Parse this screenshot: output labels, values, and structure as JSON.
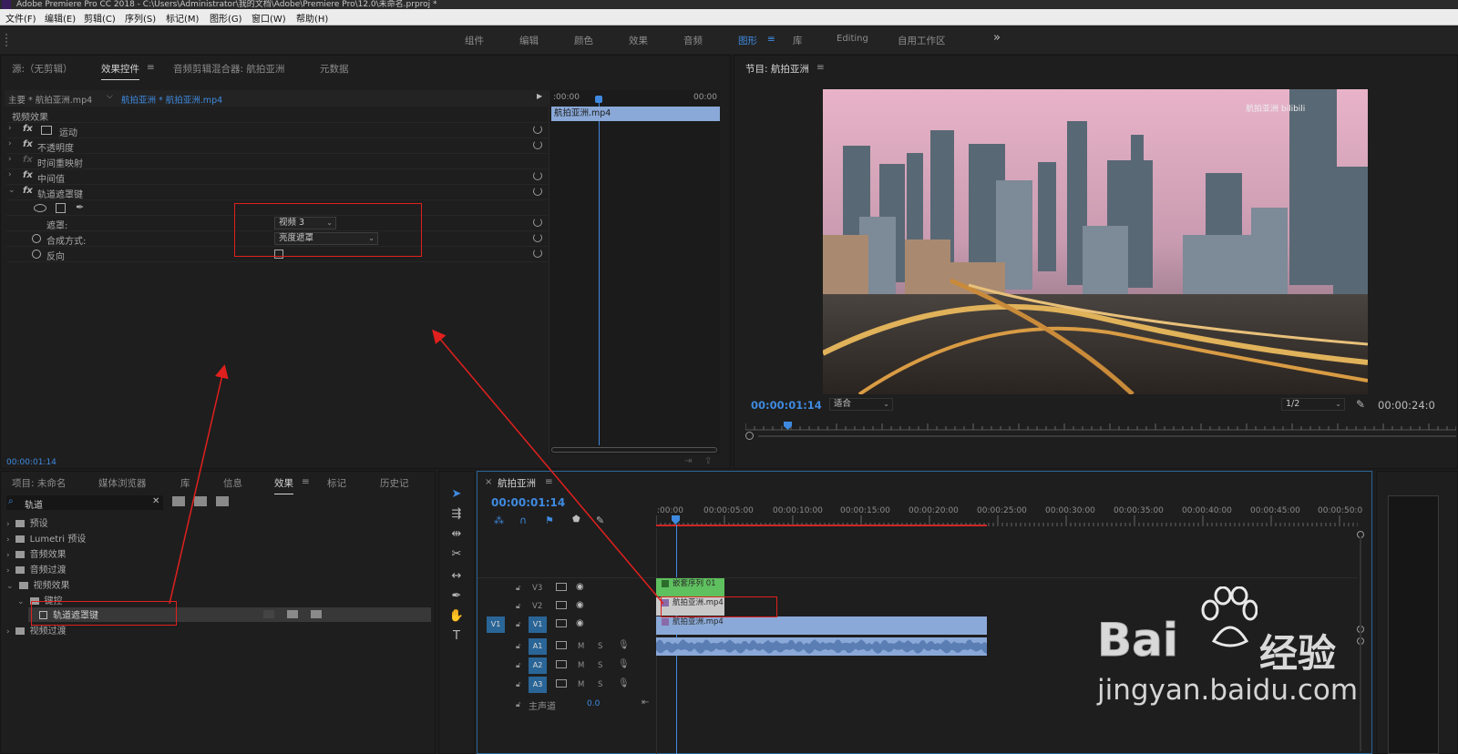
{
  "window": {
    "title": "Adobe Premiere Pro CC 2018 - C:\\Users\\Administrator\\我的文档\\Adobe\\Premiere Pro\\12.0\\未命名.prproj *"
  },
  "menu": [
    "文件(F)",
    "编辑(E)",
    "剪辑(C)",
    "序列(S)",
    "标记(M)",
    "图形(G)",
    "窗口(W)",
    "帮助(H)"
  ],
  "workspaces": [
    "组件",
    "编辑",
    "颜色",
    "效果",
    "音频",
    "图形",
    "库",
    "Editing",
    "自用工作区"
  ],
  "workspace_active": "图形",
  "workspace_more": "»",
  "source_panel": {
    "tabs": [
      "源:（无剪辑）",
      "效果控件",
      "音频剪辑混合器: 航拍亚洲",
      "元数据"
    ],
    "active_tab": "效果控件",
    "master_label": "主要 * 航拍亚洲.mp4",
    "sequence_label": "航拍亚洲 * 航拍亚洲.mp4",
    "section": "视频效果",
    "effects": [
      {
        "name": "运动",
        "fx": "fx"
      },
      {
        "name": "不透明度",
        "fx": "fx"
      },
      {
        "name": "时间重映射",
        "fx": "fx"
      },
      {
        "name": "中间值",
        "fx": "fx"
      },
      {
        "name": "轨道遮罩键",
        "fx": "fx"
      }
    ],
    "mask_label": "遮罩:",
    "mask_value": "视频 3",
    "composite_label": "合成方式:",
    "composite_value": "亮度遮罩",
    "reverse_label": "反向",
    "mini_ruler": [
      ":00:00",
      "00:00"
    ],
    "mini_clip": "航拍亚洲.mp4",
    "timecode": "00:00:01:14"
  },
  "program_monitor": {
    "title": "节目: 航拍亚洲",
    "timecode": "00:00:01:14",
    "fit": "适合",
    "resolution": "1/2",
    "duration": "00:00:24:0",
    "watermark": "航拍亚洲  bilibili"
  },
  "project_panel": {
    "tabs": [
      "项目: 未命名",
      "媒体浏览器",
      "库",
      "信息",
      "效果",
      "标记",
      "历史记"
    ],
    "active_tab": "效果",
    "search_value": "轨道",
    "tree": [
      {
        "label": "预设",
        "level": 0,
        "open": false
      },
      {
        "label": "Lumetri 预设",
        "level": 0,
        "open": false
      },
      {
        "label": "音频效果",
        "level": 0,
        "open": false
      },
      {
        "label": "音频过渡",
        "level": 0,
        "open": false
      },
      {
        "label": "视频效果",
        "level": 0,
        "open": true
      },
      {
        "label": "键控",
        "level": 1,
        "open": true
      },
      {
        "label": "轨道遮罩键",
        "level": 2,
        "open": false
      },
      {
        "label": "视频过渡",
        "level": 0,
        "open": false
      }
    ]
  },
  "timeline": {
    "tab": "航拍亚洲",
    "timecode": "00:00:01:14",
    "ruler": [
      ":00:00",
      "00:00:05:00",
      "00:00:10:00",
      "00:00:15:00",
      "00:00:20:00",
      "00:00:25:00",
      "00:00:30:00",
      "00:00:35:00",
      "00:00:40:00",
      "00:00:45:00",
      "00:00:50:0"
    ],
    "tracks": [
      {
        "name": "V3",
        "src": ""
      },
      {
        "name": "V2",
        "src": ""
      },
      {
        "name": "V1",
        "src": "V1"
      },
      {
        "name": "A1",
        "src": ""
      },
      {
        "name": "A2",
        "src": ""
      },
      {
        "name": "A3",
        "src": ""
      }
    ],
    "master_label": "主声道",
    "master_value": "0.0",
    "clips": {
      "v3": "嵌套序列 01",
      "v2": "航拍亚洲.mp4",
      "v1": "航拍亚洲.mp4"
    },
    "track_letters": {
      "mute": "M",
      "solo": "S"
    }
  },
  "watermark": {
    "brand": "Bai",
    "brand2": "经验",
    "url": "jingyan.baidu.com"
  },
  "colors": {
    "accent": "#3f8ae0",
    "annotation": "#e0201e",
    "clip_video": "#8aa9d8",
    "clip_nest": "#5ec05e"
  }
}
